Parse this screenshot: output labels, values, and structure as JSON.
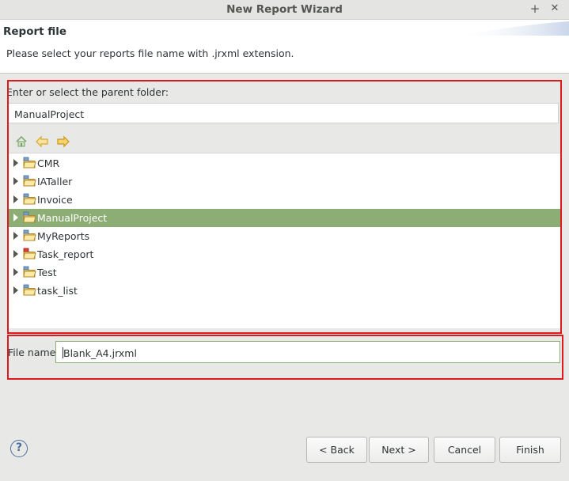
{
  "window": {
    "title": "New Report Wizard",
    "controls": {
      "minimize": "+",
      "close": "✕"
    }
  },
  "header": {
    "title": "Report file",
    "description": "Please select your reports file name with .jrxml extension."
  },
  "folder": {
    "label": "Enter or select the parent folder:",
    "value": "ManualProject"
  },
  "toolbar": {
    "icons": [
      "home-icon",
      "back-arrow-icon",
      "forward-arrow-icon"
    ]
  },
  "tree": {
    "items": [
      {
        "label": "CMR",
        "icon": "project-folder-icon",
        "selected": false
      },
      {
        "label": "IATaller",
        "icon": "project-folder-icon",
        "selected": false
      },
      {
        "label": "Invoice",
        "icon": "project-folder-icon",
        "selected": false
      },
      {
        "label": "ManualProject",
        "icon": "project-folder-icon",
        "selected": true
      },
      {
        "label": "MyReports",
        "icon": "project-folder-icon",
        "selected": false
      },
      {
        "label": "Task_report",
        "icon": "project-folder-error-icon",
        "selected": false
      },
      {
        "label": "Test",
        "icon": "project-folder-icon",
        "selected": false
      },
      {
        "label": "task_list",
        "icon": "project-folder-icon",
        "selected": false
      }
    ]
  },
  "file": {
    "label": "File name:",
    "value": "Blank_A4.jrxml"
  },
  "buttons": {
    "help": "?",
    "back": "< Back",
    "next": "Next >",
    "cancel": "Cancel",
    "finish": "Finish"
  },
  "colors": {
    "selection": "#8cad74",
    "highlight_box": "#e0191f",
    "folder_yellow": "#e8c24a"
  }
}
